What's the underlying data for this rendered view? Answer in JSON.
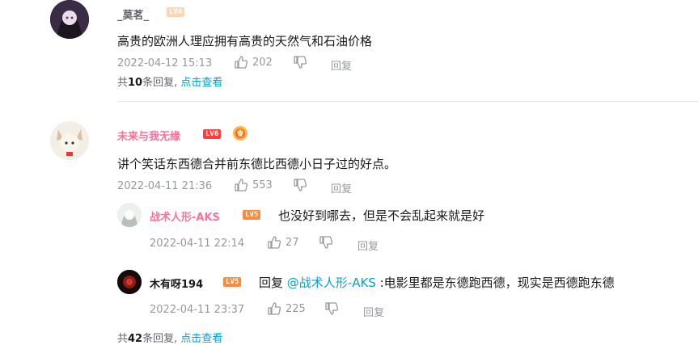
{
  "colors": {
    "link": "#00a1d6",
    "pink_name": "#fb7299",
    "meta": "#9499a0",
    "divider": "#e3e5e7"
  },
  "comments": [
    {
      "username": "_莫茗_",
      "level": "LV4",
      "content": "高贵的欧洲人理应拥有高贵的天然气和石油价格",
      "time": "2022-04-12 15:13",
      "likes": "202",
      "reply_label": "回复",
      "sub_summary": {
        "prefix": "共",
        "count": "10",
        "suffix": "条回复,",
        "link": "点击查看"
      }
    },
    {
      "username": "未来与我无缘",
      "level": "LV6",
      "content": "讲个笑话东西德合并前东德比西德小日子过的好点。",
      "time": "2022-04-11 21:36",
      "likes": "553",
      "reply_label": "回复",
      "replies": [
        {
          "username": "战术人形-AKS",
          "level": "LV5",
          "content": "也没好到哪去，但是不会乱起来就是好",
          "time": "2022-04-11 22:14",
          "likes": "27",
          "reply_label": "回复"
        },
        {
          "username": "木有呀194",
          "level": "LV5",
          "reply_prefix": "回复 ",
          "mention": "@战术人形-AKS",
          "content": " :电影里都是东德跑西德，现实是西德跑东德",
          "time": "2022-04-11 23:37",
          "likes": "225",
          "reply_label": "回复"
        }
      ],
      "sub_summary": {
        "prefix": "共",
        "count": "42",
        "suffix": "条回复,",
        "link": "点击查看"
      }
    }
  ]
}
